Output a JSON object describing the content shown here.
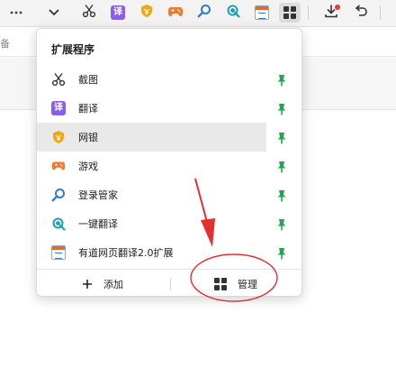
{
  "toolbar": {
    "more_icon": "more-dots-icon",
    "chevron_icon": "chevron-down-icon",
    "ext_icons": [
      "scissors-icon",
      "translate-icon",
      "bank-shield-icon",
      "gamepad-icon",
      "search-key-icon",
      "search-circle-icon",
      "calendar-icon"
    ],
    "translate_glyph": "译",
    "extensions_icon": "extensions-grid-icon",
    "download_icon": "download-icon",
    "undo_icon": "undo-icon"
  },
  "address_fragment": "备",
  "popup": {
    "title": "扩展程序",
    "items": [
      {
        "label": "截图",
        "icon": "scissors-icon",
        "pinned": true
      },
      {
        "label": "翻译",
        "icon": "translate-icon",
        "glyph": "译",
        "pinned": true
      },
      {
        "label": "网银",
        "icon": "bank-shield-icon",
        "pinned": true
      },
      {
        "label": "游戏",
        "icon": "gamepad-icon",
        "pinned": true
      },
      {
        "label": "登录管家",
        "icon": "search-key-icon",
        "pinned": true
      },
      {
        "label": "一键翻译",
        "icon": "search-circle-icon",
        "pinned": true
      },
      {
        "label": "有道网页翻译2.0扩展",
        "icon": "calendar-icon",
        "pinned": true
      }
    ],
    "add_label": "添加",
    "manage_label": "管理",
    "pin_color": "#1fa84f"
  },
  "colors": {
    "accent_red": "#e23d3d",
    "annotation_red": "#e03030"
  }
}
